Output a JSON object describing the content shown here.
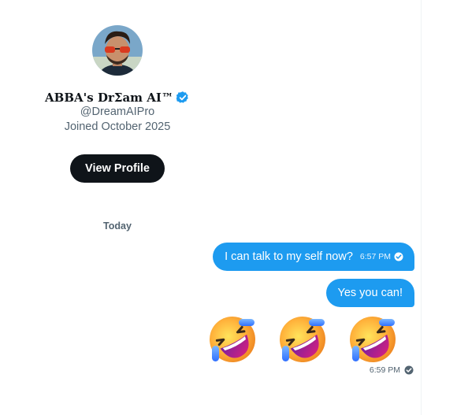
{
  "profile": {
    "name": "ABBA's DrΣam AI™",
    "handle": "@DreamAIPro",
    "joined": "Joined October 2025",
    "view_profile_label": "View Profile"
  },
  "conversation": {
    "day_separator": "Today",
    "messages": [
      {
        "text": "I can talk to my self now?",
        "time": "6:57 PM",
        "status": "read"
      },
      {
        "text": "Yes you can!"
      },
      {
        "emojis": [
          "rolling-on-the-floor-laughing",
          "rolling-on-the-floor-laughing",
          "rolling-on-the-floor-laughing"
        ],
        "time": "6:59 PM",
        "status": "read"
      }
    ]
  },
  "colors": {
    "bubble": "#1d9bf0",
    "button": "#0f1419",
    "muted": "#536471",
    "verified": "#1d9bf0"
  },
  "icons": [
    "verified-badge-icon",
    "read-check-icon",
    "rofl-emoji-icon"
  ]
}
